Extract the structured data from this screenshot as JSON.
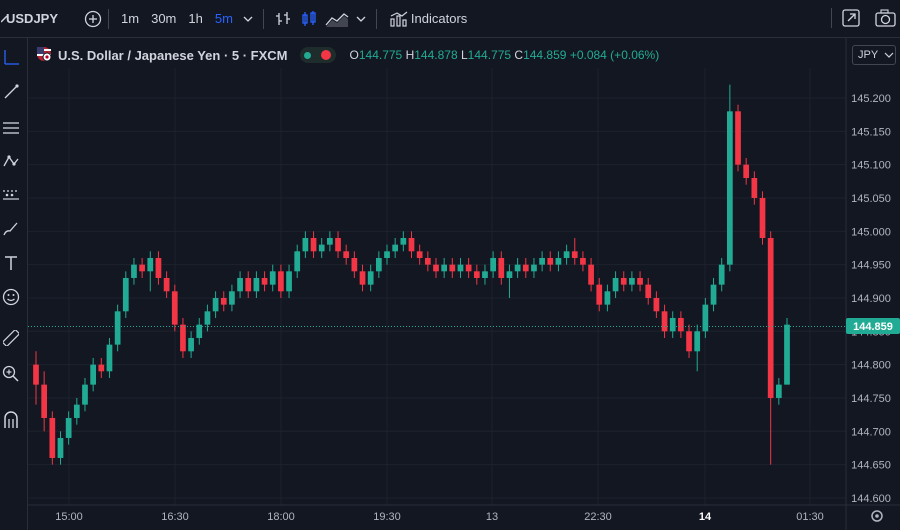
{
  "toolbar": {
    "symbol": "USDJPY",
    "intervals": [
      "1m",
      "30m",
      "1h",
      "5m"
    ],
    "active_interval": "5m",
    "indicators_label": "Indicators"
  },
  "legend": {
    "title": "U.S. Dollar / Japanese Yen · 5 · FXCM",
    "o_label": "O",
    "o_value": "144.775",
    "h_label": "H",
    "h_value": "144.878",
    "l_label": "L",
    "l_value": "144.775",
    "c_label": "C",
    "c_value": "144.859",
    "change": "+0.084 (+0.06%)"
  },
  "currency_button": "JPY",
  "colors": {
    "up": "#22ab94",
    "down": "#f23645",
    "background": "#131722",
    "price_line": "#22ab94"
  },
  "icons": {
    "left_toolbar": [
      "crosshair-icon",
      "trend-line-icon",
      "horizontal-lines-icon",
      "pattern-icon",
      "forecast-icon",
      "brush-icon",
      "text-icon",
      "emoji-icon",
      "ruler-icon",
      "zoom-in-icon",
      "magnet-icon"
    ],
    "top_right": [
      "snapshot-icon",
      "camera-icon"
    ]
  },
  "chart_data": {
    "type": "candlestick",
    "title": "U.S. Dollar / Japanese Yen · 5 · FXCM",
    "ylim": [
      144.6,
      145.24
    ],
    "y_ticks": [
      "145.200",
      "145.150",
      "145.100",
      "145.050",
      "145.000",
      "144.950",
      "144.900",
      "144.850",
      "144.800",
      "144.750",
      "144.700",
      "144.650",
      "144.600"
    ],
    "x_tick_labels": [
      "15:00",
      "16:30",
      "18:00",
      "19:30",
      "13",
      "22:30",
      "14",
      "01:30"
    ],
    "last_price": "144.859",
    "candles": [
      [
        144.8,
        144.77,
        144.82,
        144.74
      ],
      [
        144.77,
        144.72,
        144.79,
        144.7
      ],
      [
        144.72,
        144.66,
        144.73,
        144.65
      ],
      [
        144.66,
        144.69,
        144.7,
        144.65
      ],
      [
        144.69,
        144.72,
        144.73,
        144.68
      ],
      [
        144.72,
        144.74,
        144.75,
        144.71
      ],
      [
        144.74,
        144.77,
        144.78,
        144.73
      ],
      [
        144.77,
        144.8,
        144.81,
        144.76
      ],
      [
        144.8,
        144.79,
        144.81,
        144.78
      ],
      [
        144.79,
        144.83,
        144.84,
        144.78
      ],
      [
        144.83,
        144.88,
        144.89,
        144.82
      ],
      [
        144.88,
        144.93,
        144.94,
        144.87
      ],
      [
        144.93,
        144.95,
        144.96,
        144.92
      ],
      [
        144.95,
        144.94,
        144.96,
        144.93
      ],
      [
        144.94,
        144.96,
        144.97,
        144.91
      ],
      [
        144.96,
        144.93,
        144.97,
        144.92
      ],
      [
        144.93,
        144.91,
        144.94,
        144.9
      ],
      [
        144.91,
        144.86,
        144.92,
        144.85
      ],
      [
        144.86,
        144.82,
        144.87,
        144.81
      ],
      [
        144.82,
        144.84,
        144.85,
        144.81
      ],
      [
        144.84,
        144.86,
        144.87,
        144.83
      ],
      [
        144.86,
        144.88,
        144.89,
        144.85
      ],
      [
        144.88,
        144.9,
        144.91,
        144.87
      ],
      [
        144.9,
        144.89,
        144.91,
        144.88
      ],
      [
        144.89,
        144.91,
        144.92,
        144.88
      ],
      [
        144.91,
        144.93,
        144.94,
        144.9
      ],
      [
        144.93,
        144.91,
        144.94,
        144.9
      ],
      [
        144.91,
        144.93,
        144.94,
        144.9
      ],
      [
        144.93,
        144.92,
        144.94,
        144.91
      ],
      [
        144.92,
        144.94,
        144.95,
        144.91
      ],
      [
        144.94,
        144.91,
        144.95,
        144.9
      ],
      [
        144.91,
        144.94,
        144.95,
        144.9
      ],
      [
        144.94,
        144.97,
        144.98,
        144.93
      ],
      [
        144.97,
        144.99,
        145.0,
        144.96
      ],
      [
        144.99,
        144.97,
        145.0,
        144.96
      ],
      [
        144.97,
        144.98,
        144.99,
        144.96
      ],
      [
        144.98,
        144.99,
        145.0,
        144.97
      ],
      [
        144.99,
        144.97,
        145.0,
        144.96
      ],
      [
        144.97,
        144.96,
        144.98,
        144.95
      ],
      [
        144.96,
        144.94,
        144.97,
        144.93
      ],
      [
        144.94,
        144.92,
        144.95,
        144.91
      ],
      [
        144.92,
        144.94,
        144.95,
        144.91
      ],
      [
        144.94,
        144.96,
        144.97,
        144.93
      ],
      [
        144.96,
        144.97,
        144.98,
        144.95
      ],
      [
        144.97,
        144.98,
        144.99,
        144.96
      ],
      [
        144.98,
        144.99,
        145.0,
        144.97
      ],
      [
        144.99,
        144.97,
        145.0,
        144.96
      ],
      [
        144.97,
        144.96,
        144.98,
        144.95
      ],
      [
        144.96,
        144.95,
        144.97,
        144.94
      ],
      [
        144.95,
        144.94,
        144.96,
        144.93
      ],
      [
        144.94,
        144.95,
        144.96,
        144.93
      ],
      [
        144.95,
        144.94,
        144.96,
        144.93
      ],
      [
        144.94,
        144.95,
        144.96,
        144.93
      ],
      [
        144.95,
        144.94,
        144.96,
        144.93
      ],
      [
        144.94,
        144.93,
        144.95,
        144.92
      ],
      [
        144.93,
        144.94,
        144.95,
        144.92
      ],
      [
        144.94,
        144.96,
        144.97,
        144.93
      ],
      [
        144.96,
        144.93,
        144.97,
        144.92
      ],
      [
        144.93,
        144.94,
        144.95,
        144.9
      ],
      [
        144.94,
        144.95,
        144.96,
        144.93
      ],
      [
        144.95,
        144.94,
        144.96,
        144.93
      ],
      [
        144.94,
        144.95,
        144.96,
        144.93
      ],
      [
        144.95,
        144.96,
        144.97,
        144.94
      ],
      [
        144.96,
        144.95,
        144.97,
        144.94
      ],
      [
        144.95,
        144.96,
        144.97,
        144.94
      ],
      [
        144.96,
        144.97,
        144.98,
        144.95
      ],
      [
        144.97,
        144.96,
        144.99,
        144.95
      ],
      [
        144.96,
        144.95,
        144.97,
        144.94
      ],
      [
        144.95,
        144.92,
        144.96,
        144.91
      ],
      [
        144.92,
        144.89,
        144.93,
        144.88
      ],
      [
        144.89,
        144.91,
        144.92,
        144.88
      ],
      [
        144.91,
        144.93,
        144.94,
        144.9
      ],
      [
        144.93,
        144.92,
        144.94,
        144.91
      ],
      [
        144.92,
        144.93,
        144.94,
        144.91
      ],
      [
        144.93,
        144.92,
        144.94,
        144.91
      ],
      [
        144.92,
        144.9,
        144.93,
        144.89
      ],
      [
        144.9,
        144.88,
        144.91,
        144.87
      ],
      [
        144.88,
        144.85,
        144.89,
        144.84
      ],
      [
        144.85,
        144.87,
        144.88,
        144.84
      ],
      [
        144.87,
        144.85,
        144.88,
        144.84
      ],
      [
        144.85,
        144.82,
        144.86,
        144.81
      ],
      [
        144.82,
        144.85,
        144.86,
        144.79
      ],
      [
        144.85,
        144.89,
        144.9,
        144.84
      ],
      [
        144.89,
        144.92,
        144.93,
        144.88
      ],
      [
        144.92,
        144.95,
        144.96,
        144.91
      ],
      [
        144.95,
        145.18,
        145.22,
        144.94
      ],
      [
        145.18,
        145.1,
        145.19,
        145.09
      ],
      [
        145.1,
        145.08,
        145.11,
        145.07
      ],
      [
        145.08,
        145.05,
        145.09,
        145.04
      ],
      [
        145.05,
        144.99,
        145.06,
        144.98
      ],
      [
        144.99,
        144.75,
        145.0,
        144.65
      ],
      [
        144.75,
        144.77,
        144.78,
        144.74
      ],
      [
        144.77,
        144.86,
        144.87,
        144.77
      ]
    ]
  }
}
